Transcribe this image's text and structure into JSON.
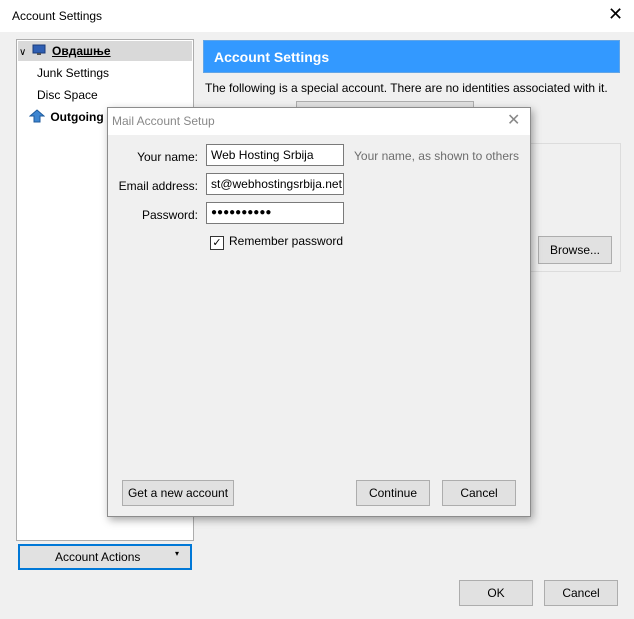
{
  "window": {
    "title": "Account Settings",
    "close": "✕"
  },
  "tree": {
    "items": [
      {
        "label": "Овдашње",
        "arrow": "∨"
      },
      {
        "label": "Junk Settings"
      },
      {
        "label": "Disc Space"
      },
      {
        "label": "Outgoing S"
      }
    ]
  },
  "header": {
    "title": "Account Settings"
  },
  "special_text": "The following is a special account. There are no identities associated with it.",
  "browse_label": "Browse...",
  "account_actions": {
    "label": "Account Actions",
    "arrow": "▾"
  },
  "footer": {
    "ok": "OK",
    "cancel": "Cancel"
  },
  "dialog": {
    "title": "Mail Account Setup",
    "close": "✕",
    "name_label": "Your name:",
    "name_value": "Web Hosting Srbija",
    "name_hint": "Your name, as shown to others",
    "email_label": "Email address:",
    "email_value": "st@webhostingsrbija.net",
    "password_label": "Password:",
    "password_value": "●●●●●●●●●●",
    "remember_label": "Remember password",
    "remember_checked": "✓",
    "get_account": "Get a new account",
    "continue": "Continue",
    "cancel": "Cancel"
  }
}
